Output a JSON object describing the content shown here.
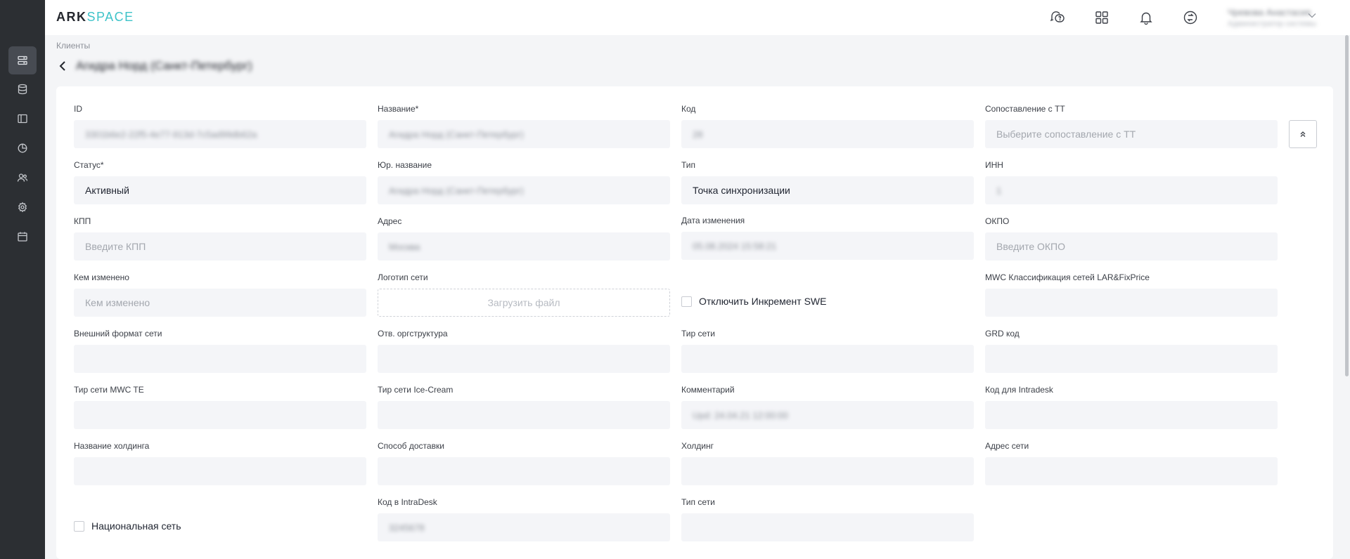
{
  "app": {
    "logo_ark": "ARK",
    "logo_space": "SPACE"
  },
  "sidebar": {
    "items": [
      {
        "icon": "list-icon",
        "active": true
      },
      {
        "icon": "database-icon",
        "active": false
      },
      {
        "icon": "panel-icon",
        "active": false
      },
      {
        "icon": "pie-chart-icon",
        "active": false
      },
      {
        "icon": "users-icon",
        "active": false
      },
      {
        "icon": "settings-icon",
        "active": false
      },
      {
        "icon": "calendar-icon",
        "active": false
      }
    ]
  },
  "header": {
    "icons": [
      "support-icon",
      "apps-grid-icon",
      "bell-icon",
      "sync-icon"
    ],
    "user_name": "Чревова Анастасия",
    "user_role": "Администратор системы"
  },
  "breadcrumb": "Клиенты",
  "page_title": "Агидра Норд (Санкт-Петербург)",
  "form": {
    "id_label": "ID",
    "id_value": "3301b6e2-22f5-4e77-913d-7c5ad99db62a",
    "name_label": "Название*",
    "name_value": "Агидра Норд (Санкт-Петербург)",
    "code_label": "Код",
    "code_value": "28",
    "tt_match_label": "Сопоставление с ТТ",
    "tt_match_placeholder": "Выберите сопоставление с ТТ",
    "status_label": "Статус*",
    "status_value": "Активный",
    "legal_name_label": "Юр. название",
    "legal_name_value": "Агидра Норд (Санкт-Петербург)",
    "type_label": "Тип",
    "type_value": "Точка синхронизации",
    "inn_label": "ИНН",
    "inn_value": "1",
    "kpp_label": "КПП",
    "kpp_placeholder": "Введите КПП",
    "address_label": "Адрес",
    "address_value": "Москва",
    "modified_date_label": "Дата изменения",
    "modified_date_value": "05.08.2024 15:58:21",
    "okpo_label": "ОКПО",
    "okpo_placeholder": "Введите ОКПО",
    "modified_by_label": "Кем изменено",
    "modified_by_placeholder": "Кем изменено",
    "logo_label": "Логотип сети",
    "logo_upload": "Загрузить файл",
    "disable_increment_label": "Отключить Инкремент SWE",
    "mwc_class_label": "MWC Классификация сетей LAR&FixPrice",
    "ext_format_label": "Внешний формат сети",
    "org_structure_label": "Отв. оргструктура",
    "network_tier_label": "Тир сети",
    "grd_code_label": "GRD код",
    "mwc_te_tier_label": "Тир сети MWC TE",
    "icecream_tier_label": "Тир сети Ice-Cream",
    "comment_label": "Комментарий",
    "comment_value": "Upd: 24.04.21 12:00:00",
    "intradesk_code_label": "Код для Intradesk",
    "holding_name_label": "Название холдинга",
    "delivery_method_label": "Способ доставки",
    "holding_label": "Холдинг",
    "network_address_label": "Адрес сети",
    "national_network_label": "Национальная сеть",
    "intradesk_code2_label": "Код в IntraDesk",
    "intradesk_code2_value": "3245678",
    "network_type_label": "Тип сети"
  },
  "colors": {
    "sidebar_bg": "#2c2f33",
    "accent": "#3ec3c9",
    "input_bg": "#f4f5f8"
  }
}
